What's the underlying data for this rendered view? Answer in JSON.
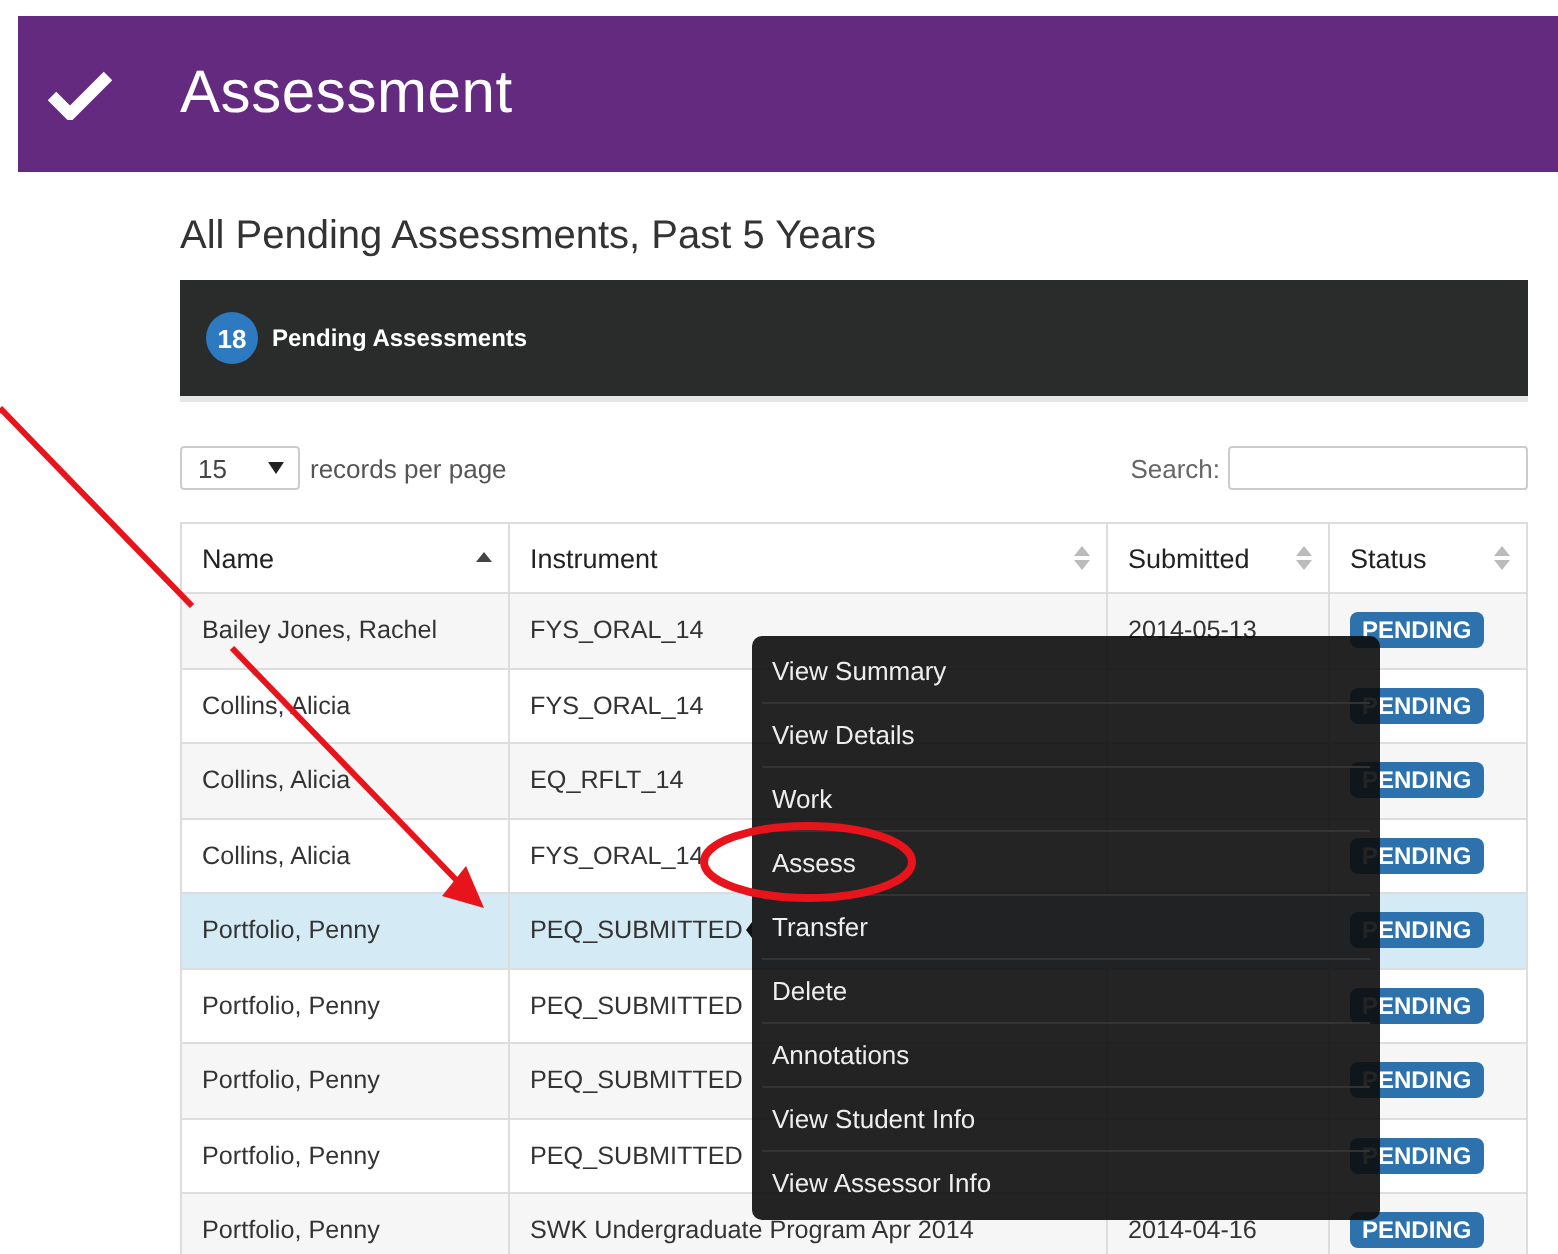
{
  "header": {
    "title": "Assessment"
  },
  "subtitle": "All Pending Assessments, Past 5 Years",
  "summary_bar": {
    "count": "18",
    "label": "Pending Assessments"
  },
  "page_size": {
    "value": "15",
    "label": "records per page"
  },
  "search": {
    "label": "Search:"
  },
  "table": {
    "columns": [
      {
        "label": "Name",
        "sorted": true
      },
      {
        "label": "Instrument",
        "sorted": false
      },
      {
        "label": "Submitted",
        "sorted": false
      },
      {
        "label": "Status",
        "sorted": false
      }
    ],
    "rows": [
      {
        "name": "Bailey Jones, Rachel",
        "instrument": "FYS_ORAL_14",
        "submitted": "2014-05-13",
        "status": "PENDING",
        "selected": false
      },
      {
        "name": "Collins, Alicia",
        "instrument": "FYS_ORAL_14",
        "status": "PENDING",
        "selected": false
      },
      {
        "name": "Collins, Alicia",
        "instrument": "EQ_RFLT_14",
        "status": "PENDING",
        "selected": false
      },
      {
        "name": "Collins, Alicia",
        "instrument": "FYS_ORAL_14",
        "status": "PENDING",
        "selected": false
      },
      {
        "name": "Portfolio, Penny",
        "instrument": "PEQ_SUBMITTED",
        "status": "PENDING",
        "selected": true
      },
      {
        "name": "Portfolio, Penny",
        "instrument": "PEQ_SUBMITTED",
        "status": "PENDING",
        "selected": false
      },
      {
        "name": "Portfolio, Penny",
        "instrument": "PEQ_SUBMITTED",
        "status": "PENDING",
        "selected": false
      },
      {
        "name": "Portfolio, Penny",
        "instrument": "PEQ_SUBMITTED",
        "status": "PENDING",
        "selected": false
      },
      {
        "name": "Portfolio, Penny",
        "instrument": "SWK Undergraduate Program Apr 2014",
        "submitted": "2014-04-16",
        "status": "PENDING",
        "selected": false
      }
    ]
  },
  "context_menu": {
    "items": [
      {
        "label": "View Summary"
      },
      {
        "label": "View Details"
      },
      {
        "label": "Work"
      },
      {
        "label": "Assess"
      },
      {
        "label": "Transfer"
      },
      {
        "label": "Delete"
      },
      {
        "label": "Annotations"
      },
      {
        "label": "View Student Info"
      },
      {
        "label": "View Assessor Info"
      }
    ]
  }
}
